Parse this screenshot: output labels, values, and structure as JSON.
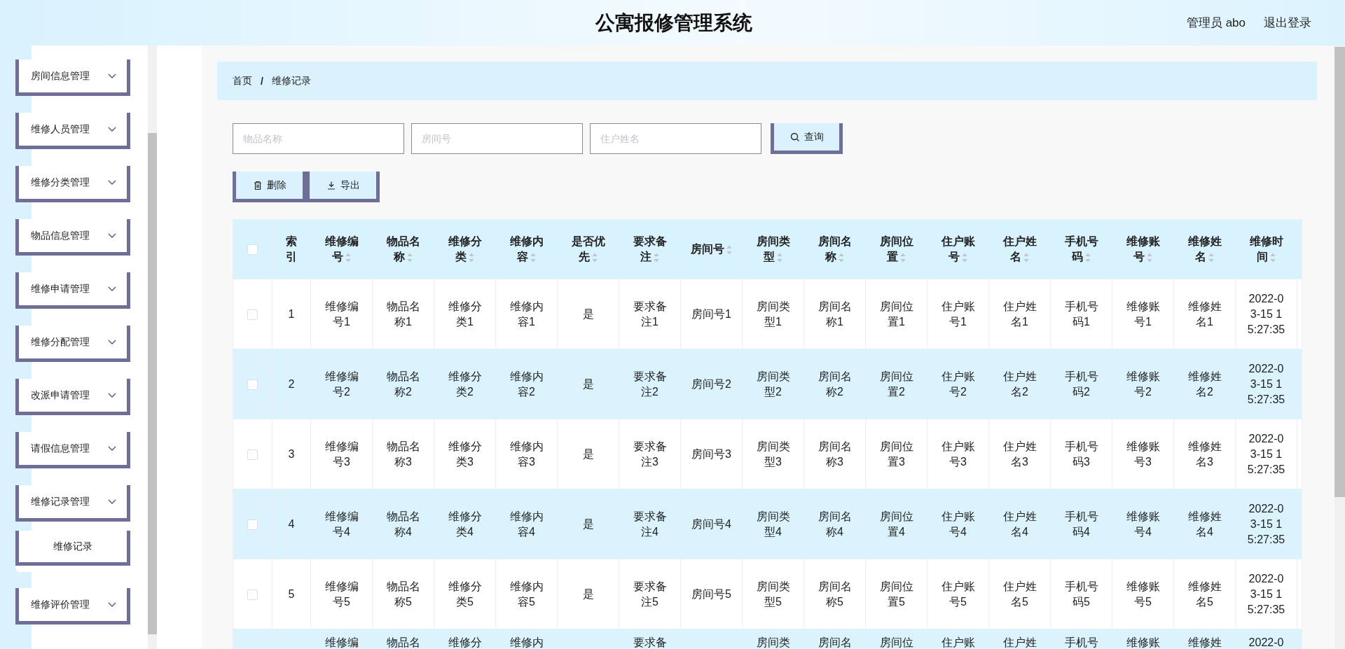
{
  "header": {
    "title": "公寓报修管理系统",
    "user": "管理员 abo",
    "logout": "退出登录"
  },
  "sidebar": {
    "items": [
      {
        "label": "房间信息管理"
      },
      {
        "label": "维修人员管理"
      },
      {
        "label": "维修分类管理"
      },
      {
        "label": "物品信息管理"
      },
      {
        "label": "维修申请管理"
      },
      {
        "label": "维修分配管理"
      },
      {
        "label": "改派申请管理"
      },
      {
        "label": "请假信息管理"
      },
      {
        "label": "维修记录管理",
        "children": [
          {
            "label": "维修记录"
          }
        ]
      },
      {
        "label": "维修评价管理"
      }
    ]
  },
  "breadcrumb": {
    "items": [
      "首页",
      "维修记录"
    ],
    "separator": "/"
  },
  "search": {
    "fields": [
      {
        "placeholder": "物品名称"
      },
      {
        "placeholder": "房间号"
      },
      {
        "placeholder": "住户姓名"
      }
    ],
    "button": "查询"
  },
  "actions": [
    {
      "kind": "delete",
      "label": "删除"
    },
    {
      "kind": "export",
      "label": "导出"
    }
  ],
  "table": {
    "select_all_checked": false,
    "columns": [
      {
        "label": "索引",
        "sortable": false
      },
      {
        "label": "维修编号",
        "sortable": true
      },
      {
        "label": "物品名称",
        "sortable": true
      },
      {
        "label": "维修分类",
        "sortable": true
      },
      {
        "label": "维修内容",
        "sortable": true
      },
      {
        "label": "是否优先",
        "sortable": true
      },
      {
        "label": "要求备注",
        "sortable": true
      },
      {
        "label": "房间号",
        "sortable": true
      },
      {
        "label": "房间类型",
        "sortable": true
      },
      {
        "label": "房间名称",
        "sortable": true
      },
      {
        "label": "房间位置",
        "sortable": true
      },
      {
        "label": "住户账号",
        "sortable": true
      },
      {
        "label": "住户姓名",
        "sortable": true
      },
      {
        "label": "手机号码",
        "sortable": true
      },
      {
        "label": "维修账号",
        "sortable": true
      },
      {
        "label": "维修姓名",
        "sortable": true
      },
      {
        "label": "维修时间",
        "sortable": true
      }
    ],
    "rows": [
      {
        "selected": false,
        "cells": [
          "1",
          "维修编号1",
          "物品名称1",
          "维修分类1",
          "维修内容1",
          "是",
          "要求备注1",
          "房间号1",
          "房间类型1",
          "房间名称1",
          "房间位置1",
          "住户账号1",
          "住户姓名1",
          "手机号码1",
          "维修账号1",
          "维修姓名1",
          "2022-03-15 15:27:35"
        ]
      },
      {
        "selected": false,
        "cells": [
          "2",
          "维修编号2",
          "物品名称2",
          "维修分类2",
          "维修内容2",
          "是",
          "要求备注2",
          "房间号2",
          "房间类型2",
          "房间名称2",
          "房间位置2",
          "住户账号2",
          "住户姓名2",
          "手机号码2",
          "维修账号2",
          "维修姓名2",
          "2022-03-15 15:27:35"
        ]
      },
      {
        "selected": false,
        "cells": [
          "3",
          "维修编号3",
          "物品名称3",
          "维修分类3",
          "维修内容3",
          "是",
          "要求备注3",
          "房间号3",
          "房间类型3",
          "房间名称3",
          "房间位置3",
          "住户账号3",
          "住户姓名3",
          "手机号码3",
          "维修账号3",
          "维修姓名3",
          "2022-03-15 15:27:35"
        ]
      },
      {
        "selected": false,
        "cells": [
          "4",
          "维修编号4",
          "物品名称4",
          "维修分类4",
          "维修内容4",
          "是",
          "要求备注4",
          "房间号4",
          "房间类型4",
          "房间名称4",
          "房间位置4",
          "住户账号4",
          "住户姓名4",
          "手机号码4",
          "维修账号4",
          "维修姓名4",
          "2022-03-15 15:27:35"
        ]
      },
      {
        "selected": false,
        "cells": [
          "5",
          "维修编号5",
          "物品名称5",
          "维修分类5",
          "维修内容5",
          "是",
          "要求备注5",
          "房间号5",
          "房间类型5",
          "房间名称5",
          "房间位置5",
          "住户账号5",
          "住户姓名5",
          "手机号码5",
          "维修账号5",
          "维修姓名5",
          "2022-03-15 15:27:35"
        ]
      }
    ],
    "partial_row": {
      "cells": [
        null,
        "维修编",
        "物品名",
        "维修分",
        "维修内",
        null,
        "要求备",
        null,
        "房间类",
        "房间名",
        "房间位",
        "住户账",
        "住户姓",
        "手机号",
        "维修账",
        "维修姓",
        "2022-0"
      ]
    }
  }
}
